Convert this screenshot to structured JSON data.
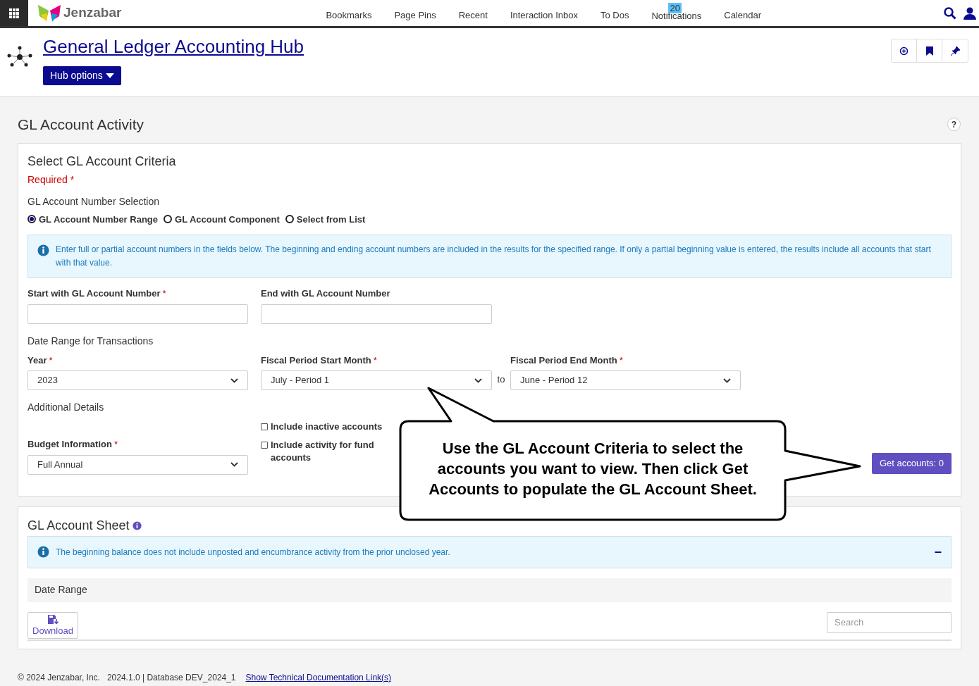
{
  "top_nav": {
    "brand": "Jenzabar",
    "links": [
      {
        "label": "Bookmarks"
      },
      {
        "label": "Page Pins"
      },
      {
        "label": "Recent"
      },
      {
        "label": "Interaction Inbox"
      },
      {
        "label": "To Dos"
      },
      {
        "label": "Notifications",
        "badge": "20"
      },
      {
        "label": "Calendar"
      }
    ]
  },
  "hub": {
    "title": "General Ledger Accounting Hub",
    "options_button": "Hub options"
  },
  "page_title": "GL Account Activity",
  "help_button": "?",
  "criteria": {
    "title": "Select GL Account Criteria",
    "required_note": "Required",
    "required_mark": "*",
    "selection_label": "GL Account Number Selection",
    "options": [
      {
        "label": "GL Account Number Range",
        "selected": true
      },
      {
        "label": "GL Account Component",
        "selected": false
      },
      {
        "label": "Select from List",
        "selected": false
      }
    ],
    "info": "Enter full or partial account numbers in the fields below. The beginning and ending account numbers are included in the results for the specified range. If only a partial beginning value is entered, the results include all accounts that start with that value.",
    "start_field": {
      "label": "Start with GL Account Number",
      "required": true
    },
    "end_field": {
      "label": "End with GL Account Number",
      "required": false
    },
    "date_range_label": "Date Range for Transactions",
    "year": {
      "label": "Year",
      "value": "2023"
    },
    "start_month": {
      "label": "Fiscal Period Start Month",
      "value": "July - Period 1"
    },
    "range_to": "to",
    "end_month": {
      "label": "Fiscal Period End Month",
      "value": "June - Period 12"
    },
    "additional_label": "Additional Details",
    "budget": {
      "label": "Budget Information",
      "value": "Full Annual"
    },
    "checkboxes": [
      {
        "label": "Include inactive accounts",
        "checked": false
      },
      {
        "label": "Include activity for fund accounts",
        "checked": false
      }
    ],
    "submit_button": "Get accounts: 0"
  },
  "callout": "Use the GL Account Criteria to select the accounts you want to view. Then click Get Accounts to populate the GL Account Sheet.",
  "sheet": {
    "title": "GL Account Sheet",
    "info": "The beginning balance does not include unposted and encumbrance activity from the prior unclosed year.",
    "collapse": "−",
    "group_header": "Date Range",
    "download_button": "Download",
    "search": {
      "placeholder": "Search"
    }
  },
  "footer": {
    "copyright": "© 2024 Jenzabar, Inc.",
    "version": "2024.1.0 | Database DEV_2024_1",
    "link": "Show Technical Documentation Link(s)"
  }
}
